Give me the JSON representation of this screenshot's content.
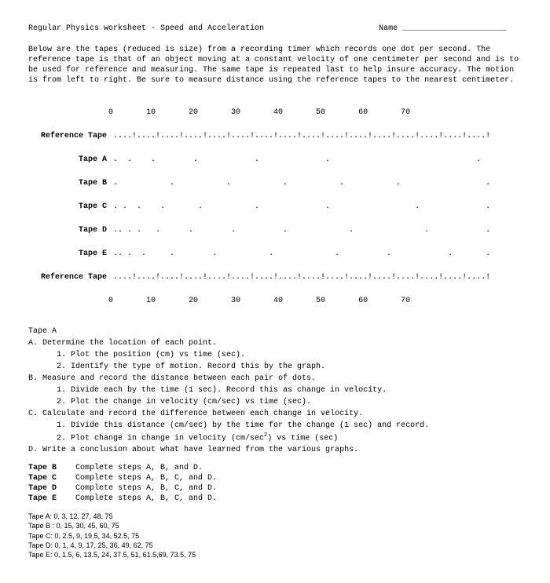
{
  "header": {
    "title": "Regular Physics worksheet - Speed and Acceleration",
    "name_label": "Name",
    "name_line": "______________________"
  },
  "intro": "Below are the tapes (reduced is size) from a recording timer which records one dot per second. The reference tape is that of an object moving at a constant velocity of one centimeter per second and is to be used for reference and measuring. The same tape is repeated last to help insure accuracy. The motion is from left to right. Be sure to measure distance using the reference tapes to the nearest centimeter.",
  "ruler": {
    "numbers": "                 0       10       20       30       40       50       60       70",
    "numbers_bottom": "                 0       10       20       30       40       50       60       70",
    "ref_label": "Reference Tape",
    "ref_pattern": "....!....!....!....!....!....!....!....!....!....!....!....!....!....!....!....!"
  },
  "tapes": [
    {
      "label": "Tape A",
      "pattern": ".  .    .        .            .              .                               ."
    },
    {
      "label": "Tape B",
      "pattern": ".           .           .           .           .           .                  ."
    },
    {
      "label": "Tape C",
      "pattern": ". .  .    .       .           .              .                  .              ."
    },
    {
      "label": "Tape D",
      "pattern": ".. . .   .      .        .          .             .               .            ."
    },
    {
      "label": "Tape E",
      "pattern": ".. .  .     .        .           .             .          .            .       ."
    }
  ],
  "instructions": {
    "tapeA_heading": "Tape A",
    "A": {
      "head": "A. Determine the location of each point.",
      "i1": "1. Plot the position (cm) vs time (sec).",
      "i2": "2. Identify the type of motion. Record this by the graph."
    },
    "B": {
      "head": "B. Measure and record the distance between each pair of dots.",
      "i1": "1. Divide each by the time (1 sec). Record this as change in velocity.",
      "i2": "2. Plot the change in velocity (cm/sec) vs time (sec)."
    },
    "C": {
      "head": "C. Calculate and record the difference between each change in velocity.",
      "i1": "1. Divide this distance (cm/sec) by the time for the change (1 sec) and record.",
      "i2a": "2. Plot change in change in velocity (cm/sec",
      "i2b": ") vs time (sec)"
    },
    "D": "D. Write a conclusion about what have learned from the various graphs."
  },
  "steps": [
    {
      "label": "Tape B",
      "text": "Complete steps A, B, and D."
    },
    {
      "label": "Tape C",
      "text": "Complete steps A, B, C, and D."
    },
    {
      "label": "Tape D",
      "text": "Complete steps A, B, C, and D."
    },
    {
      "label": "Tape E",
      "text": "Complete steps A, B, C, and D."
    }
  ],
  "data_points": [
    "Tape A:  0, 3, 12, 27, 48, 75",
    "Tape B :  0, 15, 30, 45, 60, 75",
    "Tape C:  0, 2.5, 9, 19.5, 34, 52.5, 75",
    "Tape D:  0, 1, 4, 9, 17, 25, 36, 49, 62, 75",
    "Tape E:  0, 1.5, 6, 13.5, 24, 37.5, 51, 61.5,69, 73.5, 75"
  ]
}
